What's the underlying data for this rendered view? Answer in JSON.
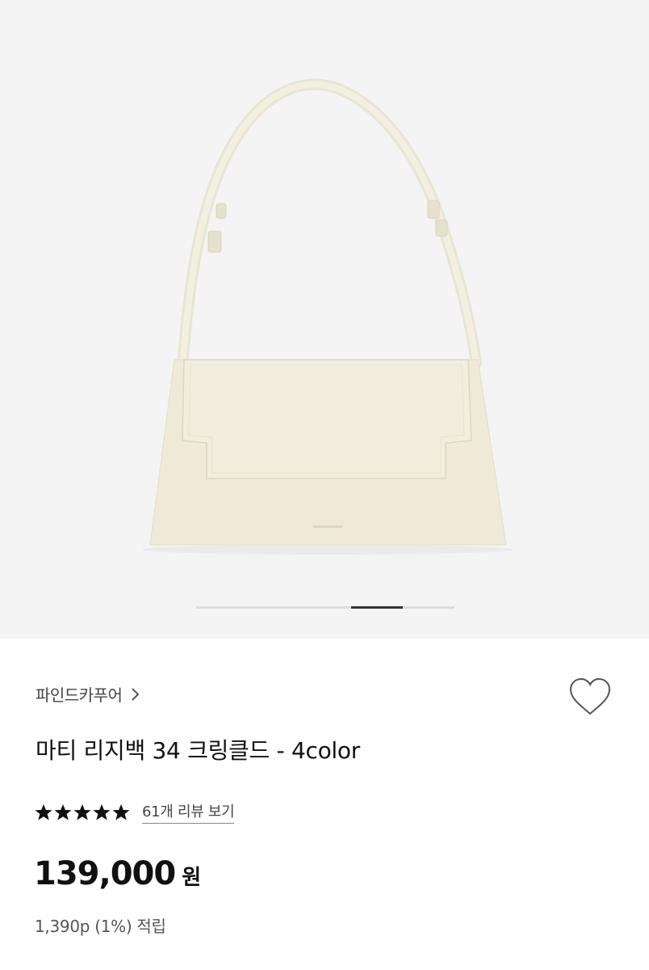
{
  "gallery": {
    "image_alt": "product-bag-image",
    "bag_color": "#efebd9",
    "background_color": "#f4f4f4",
    "pager": {
      "current_index": 4,
      "total": 5
    }
  },
  "product": {
    "brand": "파인드카푸어",
    "title": "마티 리지백 34 크링클드 - 4color",
    "rating_stars": 5,
    "review_link": "61개 리뷰 보기",
    "price": "139,000",
    "price_unit": "원",
    "points": "1,390p (1%) 적립"
  },
  "icons": {
    "brand_chevron": "chevron-right-icon",
    "wishlist": "heart-outline-icon",
    "star": "star-filled-icon"
  }
}
